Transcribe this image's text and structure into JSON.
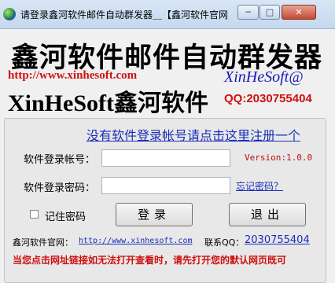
{
  "window": {
    "title": "请登录鑫河软件邮件自动群发器＿【鑫河软件官网",
    "controls": {
      "minimize": "─",
      "maximize": "□",
      "close": "✕"
    }
  },
  "banner": {
    "title": "鑫河软件邮件自动群发器",
    "url": "http://www.xinhesoft.com",
    "brand_italic": "XinHeSoft@",
    "company": "XinHeSoft鑫河软件",
    "qq": "QQ:2030755404"
  },
  "form": {
    "register_link": "没有软件登录帐号请点击这里注册一个",
    "account_label": "软件登录帐号：",
    "account_value": "",
    "password_label": "软件登录密码：",
    "password_value": "",
    "version": "Version:1.0.0",
    "forgot_link": "忘记密码？",
    "remember_label": "记住密码",
    "remember_checked": false,
    "login_button": "登录",
    "exit_button": "退出"
  },
  "footer": {
    "site_label": "鑫河软件官网：",
    "site_link": "http://www.xinhesoft.com",
    "qq_label": "联系QQ：",
    "qq_link": "2030755404",
    "notice": "当您点击网址链接如无法打开查看时，请先打开您的默认网页既可"
  },
  "colors": {
    "accent_red": "#d01010",
    "link_blue": "#1a2eb8",
    "italic_blue": "#1a1ab8"
  }
}
